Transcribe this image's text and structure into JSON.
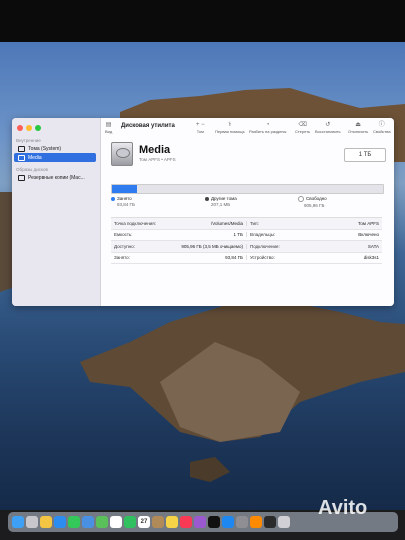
{
  "window": {
    "app_title": "Дисковая утилита",
    "sidebar": {
      "section_internal": "Внутренние",
      "section_images": "Образы дисков",
      "items": [
        {
          "label": "Тома (System)"
        },
        {
          "label": "Media"
        },
        {
          "label": "Резервные копии (Mac..."
        }
      ]
    },
    "toolbar": {
      "view": "Вид",
      "volume": "Том",
      "first_aid": "Первая помощь",
      "partition": "Разбить на разделы",
      "erase": "Стереть",
      "restore": "Восстановить",
      "unmount": "Отключить",
      "info": "Свойства"
    },
    "volume": {
      "name": "Media",
      "subtitle": "Том APFS • APFS",
      "capacity": "1 ТБ"
    },
    "usage": {
      "used_fraction": 0.094,
      "used_label": "Занято",
      "used_value": "93,84 ГБ",
      "other_label": "Другие тома",
      "other_value": "207,1 МБ",
      "free_label": "Свободно",
      "free_value": "905,96 ГБ"
    },
    "info_rows": [
      {
        "k1": "Точка подключения:",
        "v1": "/Volumes/Media",
        "k2": "Тип:",
        "v2": "Том APFS"
      },
      {
        "k1": "Емкость:",
        "v1": "1 ТБ",
        "k2": "Владельцы:",
        "v2": "Включено"
      },
      {
        "k1": "Доступно:",
        "v1": "905,96 ГБ (3,5 МБ очищаемо)",
        "k2": "Подключение:",
        "v2": "SATA"
      },
      {
        "k1": "Занято:",
        "v1": "93,84 ГБ",
        "k2": "Устройство:",
        "v2": "disk3s1"
      }
    ],
    "colors": {
      "accent": "#2f6fe0",
      "used_bar": "#2f7cf0",
      "other": "#444444",
      "free": "#e4e3ea"
    }
  },
  "dock": {
    "calendar_day": "27",
    "icons": [
      "finder-icon",
      "launchpad-icon",
      "chrome-icon",
      "safari-icon",
      "messages-icon",
      "mail-icon",
      "maps-icon",
      "photos-icon",
      "facetime-icon",
      "calendar-icon",
      "contacts-icon",
      "notes-icon",
      "music-icon",
      "podcasts-icon",
      "appletv-icon",
      "appstore-icon",
      "settings-icon",
      "vlc-icon",
      "vpn-icon",
      "trash-icon"
    ]
  },
  "watermark": "Avito"
}
